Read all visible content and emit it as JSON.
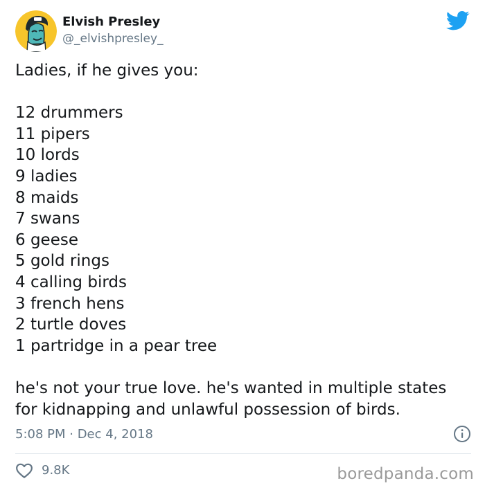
{
  "author": {
    "display_name": "Elvish Presley",
    "handle": "@_elvishpresley_"
  },
  "tweet": {
    "intro": "Ladies, if he gives you:",
    "list": [
      "12 drummers",
      "11 pipers",
      "10 lords",
      "9 ladies",
      "8 maids",
      "7 swans",
      "6 geese",
      "5 gold rings",
      "4 calling birds",
      "3 french hens",
      "2 turtle doves",
      "1 partridge in a pear tree"
    ],
    "conclusion_line1": "he's not your true love. he's wanted in multiple states",
    "conclusion_line2": "for kidnapping and unlawful possession of birds."
  },
  "meta": {
    "timestamp": "5:08 PM · Dec 4, 2018"
  },
  "engagement": {
    "likes": "9.8K"
  },
  "watermark": "boredpanda.com",
  "colors": {
    "twitter_blue": "#1da1f2",
    "secondary_text": "#657786",
    "primary_text": "#14171a",
    "divider": "#e1e8ed",
    "avatar_background": "#f7c52b"
  },
  "icons": {
    "brand": "twitter-bird-icon",
    "info": "info-icon",
    "like": "heart-icon"
  }
}
